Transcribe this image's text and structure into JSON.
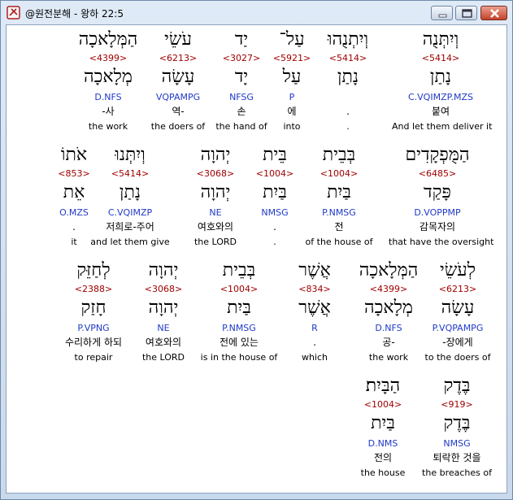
{
  "window": {
    "title": "@원전분해 - 왕하 22:5"
  },
  "rows": [
    {
      "words": [
        {
          "hebrew": "וְיִתְּנֻה",
          "strong": "<5414>",
          "lemma": "נָתַן",
          "parse": "C.VQIMZP.MZS",
          "korean": "붙여",
          "english": "And let them deliver it",
          "selected": true
        },
        {
          "hebrew": "וְיִתְנֻהוּ",
          "strong": "<5414>",
          "lemma": "נָתַן",
          "parse": "",
          "korean": ".",
          "english": "."
        },
        {
          "hebrew": "עַל־",
          "strong": "<5921>",
          "lemma": "עַל",
          "parse": "P",
          "korean": "에",
          "english": "into"
        },
        {
          "hebrew": "יַד",
          "strong": "<3027>",
          "lemma": "יָד",
          "parse": "NFSG",
          "korean": "손",
          "english": "the hand of"
        },
        {
          "hebrew": "עֹשֵׂי",
          "strong": "<6213>",
          "lemma": "עָשָׂה",
          "parse": "VQPAMPG",
          "korean": "역-",
          "english": "the doers of"
        },
        {
          "hebrew": "הַמְּלָאכָה",
          "strong": "<4399>",
          "lemma": "מְלָאכָה",
          "parse": "D.NFS",
          "korean": "-사",
          "english": "the work"
        }
      ]
    },
    {
      "words": [
        {
          "hebrew": "הַמֻּפְקָדִים",
          "strong": "<6485>",
          "lemma": "פָּקַד",
          "parse": "D.VOPPMP",
          "korean": "감목자의",
          "english": "that have the oversight"
        },
        {
          "hebrew": "בְּבֵית",
          "strong": "<1004>",
          "lemma": "בַּיִת",
          "parse": "P.NMSG",
          "korean": "전",
          "english": "of the house of"
        },
        {
          "hebrew": "בֵּית",
          "strong": "<1004>",
          "lemma": "בַּיִת",
          "parse": "NMSG",
          "korean": ".",
          "english": "."
        },
        {
          "hebrew": "יְהוָה",
          "strong": "<3068>",
          "lemma": "יְהוָה",
          "parse": "NE",
          "korean": "여호와의",
          "english": "the LORD"
        },
        {
          "hebrew": "וְיִתְּנוּ",
          "strong": "<5414>",
          "lemma": "נָתַן",
          "parse": "C.VQIMZP",
          "korean": "저희로-주어",
          "english": "and let them give"
        },
        {
          "hebrew": "אֹתוֹ",
          "strong": "<853>",
          "lemma": "אֵת",
          "parse": "O.MZS",
          "korean": ".",
          "english": "it"
        }
      ]
    },
    {
      "words": [
        {
          "hebrew": "לְעֹשֵׂי",
          "strong": "<6213>",
          "lemma": "עָשָׂה",
          "parse": "P.VQPAMPG",
          "korean": "-장에게",
          "english": "to the doers of"
        },
        {
          "hebrew": "הַמְּלָאכָה",
          "strong": "<4399>",
          "lemma": "מְלָאכָה",
          "parse": "D.NFS",
          "korean": "공-",
          "english": "the work"
        },
        {
          "hebrew": "אֲשֶׁר",
          "strong": "<834>",
          "lemma": "אֲשֶׁר",
          "parse": "R",
          "korean": ".",
          "english": "which"
        },
        {
          "hebrew": "בְּבֵית",
          "strong": "<1004>",
          "lemma": "בַּיִת",
          "parse": "P.NMSG",
          "korean": "전에 있는",
          "english": "is in the house of"
        },
        {
          "hebrew": "יְהוָה",
          "strong": "<3068>",
          "lemma": "יְהוָה",
          "parse": "NE",
          "korean": "여호와의",
          "english": "the LORD"
        },
        {
          "hebrew": "לְחַזֵּק",
          "strong": "<2388>",
          "lemma": "חָזַק",
          "parse": "P.VPNG",
          "korean": "수리하게 하되",
          "english": "to repair"
        }
      ]
    },
    {
      "words": [
        {
          "hebrew": "בֶּדֶק",
          "strong": "<919>",
          "lemma": "בֶּדֶק",
          "parse": "NMSG",
          "korean": "퇴락한 것을",
          "english": "the breaches of"
        },
        {
          "hebrew": "הַבָּיִת׃",
          "strong": "<1004>",
          "lemma": "בַּיִת",
          "parse": "D.NMS",
          "korean": "전의",
          "english": "the house"
        }
      ]
    }
  ]
}
